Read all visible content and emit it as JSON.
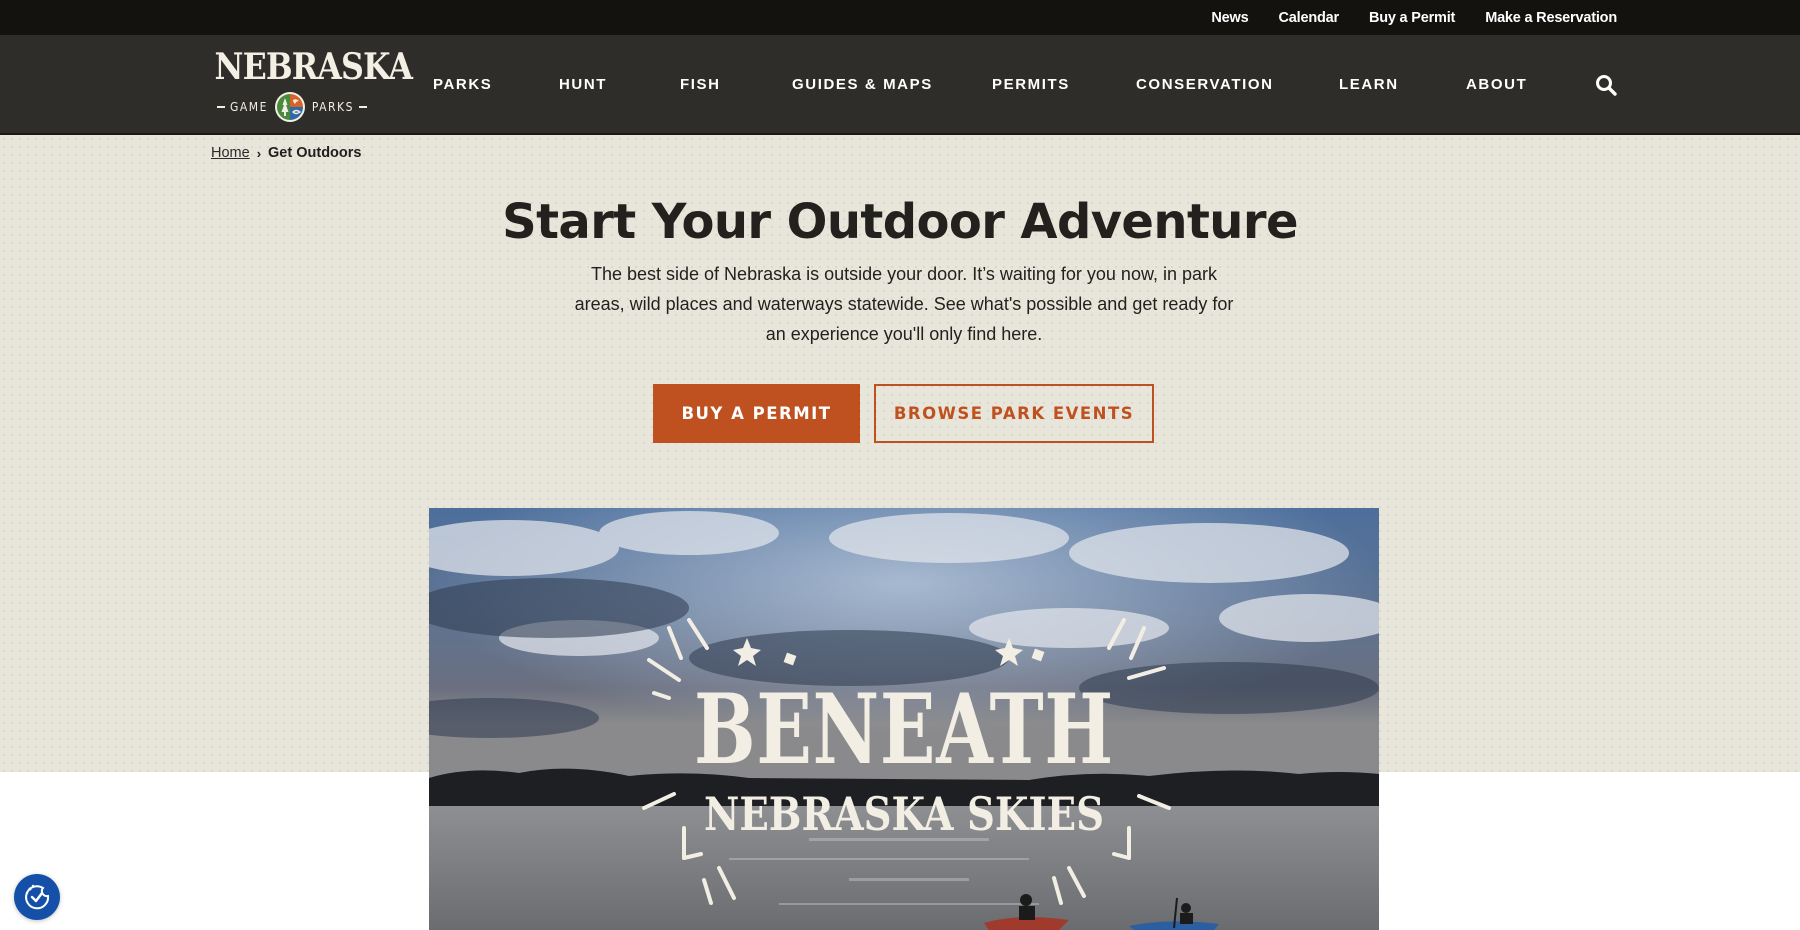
{
  "utility_nav": {
    "links": [
      "News",
      "Calendar",
      "Buy a Permit",
      "Make a Reservation"
    ]
  },
  "brand": {
    "name": "NEBRASKA",
    "sub_left": "GAME",
    "sub_right": "PARKS",
    "emblem_colors": {
      "tree": "#4a8a3c",
      "bird": "#d7632a",
      "fish": "#2e6aa6",
      "ring": "#f3efe4"
    }
  },
  "main_nav": {
    "items": [
      "PARKS",
      "HUNT",
      "FISH",
      "GUIDES & MAPS",
      "PERMITS",
      "CONSERVATION",
      "LEARN",
      "ABOUT"
    ],
    "search_icon": "search-icon"
  },
  "breadcrumb": {
    "home": "Home",
    "separator": "›",
    "current": "Get Outdoors"
  },
  "hero": {
    "title": "Start Your Outdoor Adventure",
    "description": "The best side of Nebraska is outside your door. It’s waiting for you now, in park areas, wild places and waterways statewide. See what's possible and get ready for an experience you'll only find here.",
    "primary_button": "BUY A PERMIT",
    "secondary_button": "BROWSE PARK EVENTS"
  },
  "feature_image": {
    "headline_top": "BENEATH",
    "headline_bottom": "NEBRASKA SKIES",
    "alt": "Kayakers on a lake beneath dramatic clouds"
  },
  "accessibility": {
    "icon": "accessibility-icon"
  },
  "colors": {
    "utility_bar": "#13120f",
    "nav_bar": "#2f2d2a",
    "hero_bg": "#e8e6da",
    "accent": "#bf5120",
    "text_dark": "#23211e",
    "a11y_blue": "#1550a8"
  }
}
